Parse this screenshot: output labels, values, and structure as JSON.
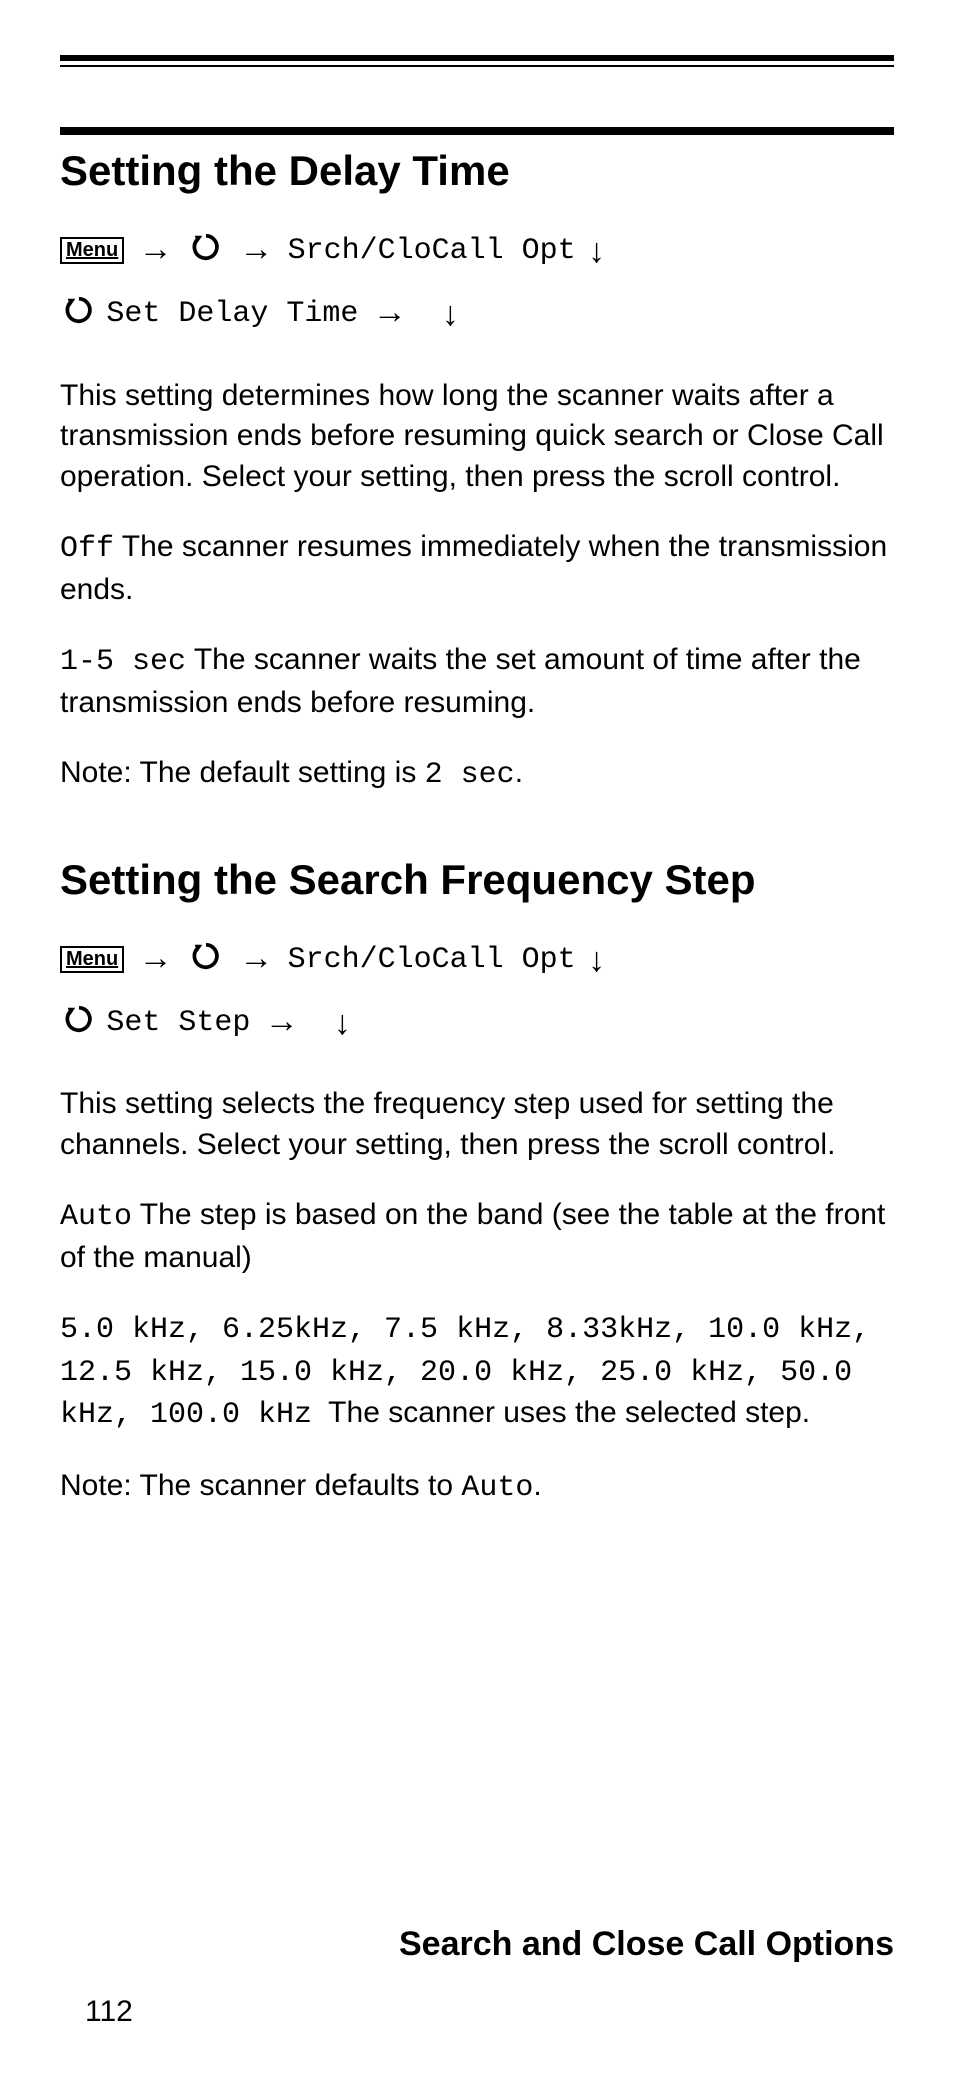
{
  "page_number": "112",
  "footer_title": "Search and Close Call Options",
  "menu_label": "Menu",
  "section1": {
    "title": "Setting the Delay Time",
    "nav": {
      "item1": "Srch/CloCall Opt",
      "item2": "Set Delay Time"
    },
    "para_intro": "This setting determines how long the scanner waits after a transmission ends before resuming quick search or Close Call operation. Select your setting, then press the scroll control.",
    "opt_off_label": "Off",
    "opt_off_text": " The scanner resumes immediately when the transmission ends.",
    "opt_range_label": "1-5 sec",
    "opt_range_text": " The scanner waits the set amount of time after the transmission ends before resuming.",
    "note_prefix": "Note: The default setting is ",
    "note_value": "2 sec",
    "note_suffix": "."
  },
  "section2": {
    "title": "Setting the Search Frequency Step",
    "nav": {
      "item1": "Srch/CloCall Opt",
      "item2": "Set Step"
    },
    "para_intro": "This setting selects the frequency step used for setting the channels. Select your setting, then press the scroll control.",
    "opt_auto_label": "Auto",
    "opt_auto_text": " The step is based on the band (see the table at the front of the manual)",
    "opt_steps_label": "5.0 kHz, 6.25kHz, 7.5 kHz, 8.33kHz, 10.0 kHz, 12.5 kHz, 15.0 kHz, 20.0 kHz, 25.0 kHz, 50.0 kHz, 100.0 kHz",
    "opt_steps_text": " The scanner uses the selected step.",
    "note_prefix": "Note: The scanner defaults to ",
    "note_value": "Auto",
    "note_suffix": "."
  }
}
